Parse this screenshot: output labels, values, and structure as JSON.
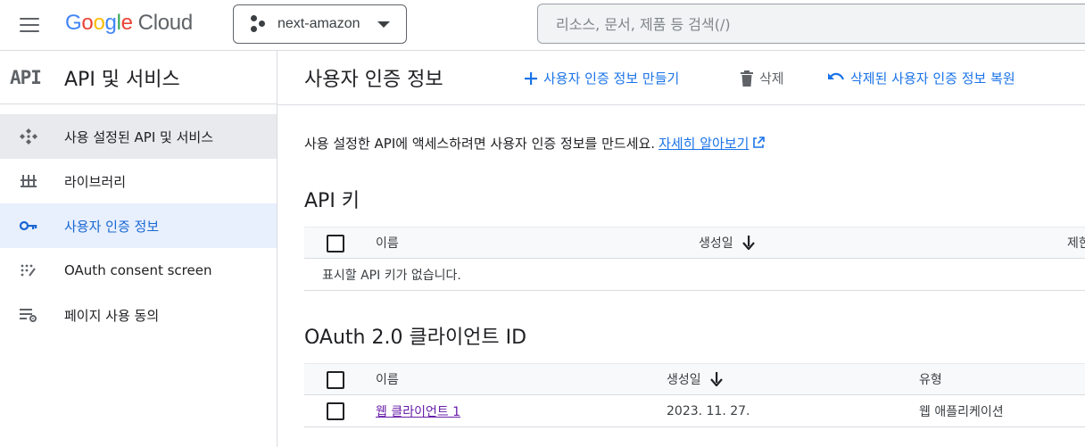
{
  "topbar": {
    "logo_google": [
      "G",
      "o",
      "o",
      "g",
      "l",
      "e"
    ],
    "logo_cloud": "Cloud",
    "project_name": "next-amazon",
    "search_placeholder": "리소스, 문서, 제품 등 검색(/)"
  },
  "sidebar": {
    "badge": "API",
    "title": "API 및 서비스",
    "items": [
      {
        "label": "사용 설정된 API 및 서비스",
        "icon": "enabled-apis-icon"
      },
      {
        "label": "라이브러리",
        "icon": "library-icon"
      },
      {
        "label": "사용자 인증 정보",
        "icon": "key-icon"
      },
      {
        "label": "OAuth consent screen",
        "icon": "oauth-consent-icon"
      },
      {
        "label": "페이지 사용 동의",
        "icon": "page-usage-agreement-icon"
      }
    ]
  },
  "main": {
    "title": "사용자 인증 정보",
    "actions": {
      "create": "사용자 인증 정보 만들기",
      "delete": "삭제",
      "restore": "삭제된 사용자 인증 정보 복원"
    },
    "intro_text": "사용 설정한 API에 액세스하려면 사용자 인증 정보를 만드세요.",
    "learn_more": "자세히 알아보기",
    "api_keys": {
      "title": "API 키",
      "columns": [
        "이름",
        "생성일",
        "제한"
      ],
      "empty": "표시할 API 키가 없습니다."
    },
    "oauth": {
      "title": "OAuth 2.0 클라이언트 ID",
      "columns": [
        "이름",
        "생성일",
        "유형"
      ],
      "rows": [
        {
          "name": "웹 클라이언트 1",
          "created": "2023. 11. 27.",
          "type": "웹 애플리케이션"
        }
      ]
    }
  },
  "colors": {
    "accent": "#1a73e8",
    "active_bg": "#e8f0fe",
    "active_text": "#1967d2",
    "visited_link": "#681da8"
  }
}
